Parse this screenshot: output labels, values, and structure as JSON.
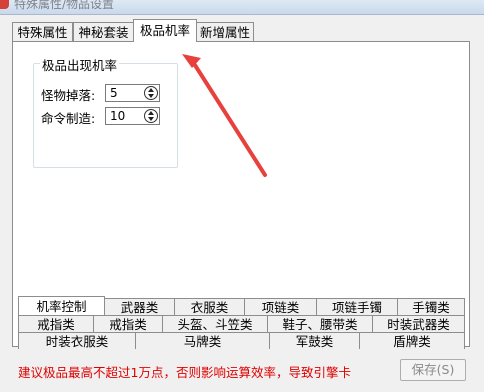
{
  "window": {
    "title": "特殊属性/物品设置"
  },
  "top_tabs": [
    {
      "label": "特殊属性",
      "active": false
    },
    {
      "label": "神秘套装",
      "active": false
    },
    {
      "label": "极品机率",
      "active": true
    },
    {
      "label": "新增属性",
      "active": false
    }
  ],
  "group": {
    "title": "极品出现机率",
    "fields": [
      {
        "label": "怪物掉落:",
        "value": "5"
      },
      {
        "label": "命令制造:",
        "value": "10"
      }
    ]
  },
  "bottom_tabs": {
    "row1": [
      "机率控制",
      "武器类",
      "衣服类",
      "项链类",
      "项链手镯",
      "手镯类"
    ],
    "row2": [
      "戒指类",
      "戒指类",
      "头盔、斗笠类",
      "鞋子、腰带类",
      "时装武器类"
    ],
    "row3": [
      "时装衣服类",
      "马牌类",
      "军鼓类",
      "盾牌类"
    ],
    "active": "机率控制"
  },
  "footer": {
    "warning": "建议极品最高不超过1万点，否则影响运算效率，导致引擎卡",
    "save_label": "保存(S)",
    "warning_color": "#e00000"
  },
  "annotation": {
    "arrow_color": "#e8403a"
  }
}
